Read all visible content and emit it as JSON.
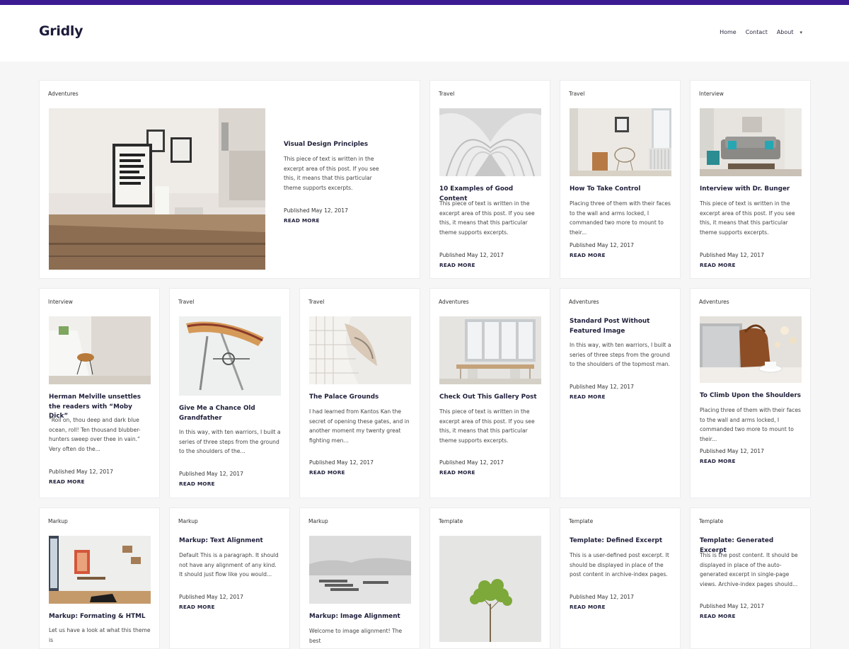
{
  "site": {
    "title": "Gridly"
  },
  "nav": {
    "home": "Home",
    "contact": "Contact",
    "about": "About",
    "about_caret": "▾"
  },
  "colors": {
    "accent": "#3b1a92",
    "heading": "#1e1e3a",
    "background": "#f6f6f7"
  },
  "posts": [
    {
      "category": "Adventures",
      "title": "Visual Design Principles",
      "excerpt": "This piece of text is written in the excerpt area of this post. If you see this, it means that this particular theme supports excerpts.",
      "published": "Published May 12, 2017",
      "more": "READ MORE",
      "image": "kitchen-table-photo"
    },
    {
      "category": "Travel",
      "title": "10 Examples of Good Content",
      "excerpt": "This piece of text is written in the excerpt area of this post. If you see this, it means that this particular theme supports excerpts.",
      "published": "Published May 12, 2017",
      "more": "READ MORE",
      "image": "white-arches-photo"
    },
    {
      "category": "Travel",
      "title": "How To Take Control",
      "excerpt": "Placing three of them with their faces to the wall and arms locked, I commanded two more to mount to their...",
      "published": "Published May 12, 2017",
      "more": "READ MORE",
      "image": "room-chair-photo"
    },
    {
      "category": "Interview",
      "title": "Interview with Dr. Bunger",
      "excerpt": "This piece of text is written in the excerpt area of this post. If you see this, it means that this particular theme supports excerpts.",
      "published": "Published May 12, 2017",
      "more": "READ MORE",
      "image": "sofa-photo"
    },
    {
      "category": "Interview",
      "title": "Herman Melville unsettles the readers with “Moby Dick”",
      "excerpt": "“Roll on, thou deep and dark blue ocean, roll! Ten thousand blubber-hunters sweep over thee in vain.” Very often do the...",
      "published": "Published May 12, 2017",
      "more": "READ MORE",
      "image": "stair-chair-photo"
    },
    {
      "category": "Travel",
      "title": "Give Me a Chance Old Grandfather",
      "excerpt": "In this way, with ten warriors, I built a series of three steps from the ground to the shoulders of the...",
      "published": "Published May 12, 2017",
      "more": "READ MORE",
      "image": "bike-seat-photo"
    },
    {
      "category": "Travel",
      "title": "The Palace Grounds",
      "excerpt": "I had learned from Kantos Kan the secret of opening these gates, and in another moment my twenty great fighting men...",
      "published": "Published May 12, 2017",
      "more": "READ MORE",
      "image": "architecture-photo"
    },
    {
      "category": "Adventures",
      "title": "Check Out This Gallery Post",
      "excerpt": "This piece of text is written in the excerpt area of this post. If you see this, it means that this particular theme supports excerpts.",
      "published": "Published May 12, 2017",
      "more": "READ MORE",
      "image": "dining-room-photo"
    },
    {
      "category": "Adventures",
      "title": "Standard Post Without Featured Image",
      "excerpt": "In this way, with ten warriors, I built a series of three steps from the ground to the shoulders of the topmost man.",
      "published": "Published May 12, 2017",
      "more": "READ MORE",
      "image": ""
    },
    {
      "category": "Adventures",
      "title": "To Climb Upon the Shoulders",
      "excerpt": "Placing three of them with their faces to the wall and arms locked, I commanded two more to mount to their...",
      "published": "Published May 12, 2017",
      "more": "READ MORE",
      "image": "laptop-bag-photo"
    },
    {
      "category": "Markup",
      "title": "Markup: Formating & HTML",
      "excerpt": "Let us have a look at what this theme is",
      "published": "",
      "more": "",
      "image": "white-office-photo"
    },
    {
      "category": "Markup",
      "title": "Markup: Text Alignment",
      "excerpt": "Default This is a paragraph. It should not have any alignment of any kind. It should just flow like you would...",
      "published": "Published May 12, 2017",
      "more": "READ MORE",
      "image": ""
    },
    {
      "category": "Markup",
      "title": "Markup: Image Alignment",
      "excerpt": "Welcome to image alignment! The best",
      "published": "",
      "more": "",
      "image": "boats-fog-photo"
    },
    {
      "category": "Template",
      "title": "",
      "excerpt": "",
      "published": "",
      "more": "",
      "image": "plant-photo"
    },
    {
      "category": "Template",
      "title": "Template: Defined Excerpt",
      "excerpt": "This is a user-defined post excerpt. It should be displayed in place of the post content in archive-index pages.",
      "published": "Published May 12, 2017",
      "more": "READ MORE",
      "image": ""
    },
    {
      "category": "Template",
      "title": "Template: Generated Excerpt",
      "excerpt": "This is the post content. It should be displayed in place of the auto-generated excerpt in single-page views. Archive-index pages should...",
      "published": "Published May 12, 2017",
      "more": "READ MORE",
      "image": ""
    }
  ]
}
